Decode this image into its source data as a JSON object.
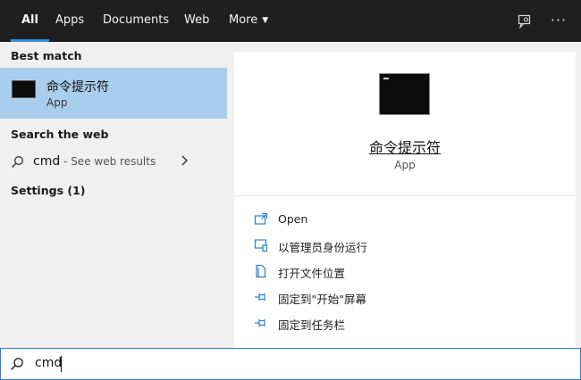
{
  "nav": {
    "tabs": [
      {
        "label": "All",
        "active": true
      },
      {
        "label": "Apps"
      },
      {
        "label": "Documents"
      },
      {
        "label": "Web"
      },
      {
        "label": "More"
      }
    ],
    "icons": [
      "feedback-icon",
      "more-options-icon"
    ]
  },
  "left": {
    "best_match_title": "Best match",
    "best_match": {
      "title": "命令提示符",
      "subtitle": "App",
      "icon": "terminal-icon"
    },
    "search_web_title": "Search the web",
    "web_result": {
      "query": "cmd",
      "hint": " - See web results",
      "icon": "search-icon"
    },
    "settings_title": "Settings (1)"
  },
  "right": {
    "title": "命令提示符",
    "subtitle": "App",
    "actions": [
      {
        "label": "Open",
        "icon": "open-icon"
      },
      {
        "label": "以管理员身份运行",
        "icon": "run-as-admin-icon"
      },
      {
        "label": "打开文件位置",
        "icon": "file-location-icon"
      },
      {
        "label": "固定到\"开始\"屏幕",
        "icon": "pin-start-icon"
      },
      {
        "label": "固定到任务栏",
        "icon": "pin-taskbar-icon"
      }
    ]
  },
  "search": {
    "value": "cmd"
  },
  "colors": {
    "topbar": "#1f1f1f",
    "accent": "#3a8fd6",
    "selected": "#a9cdec"
  }
}
